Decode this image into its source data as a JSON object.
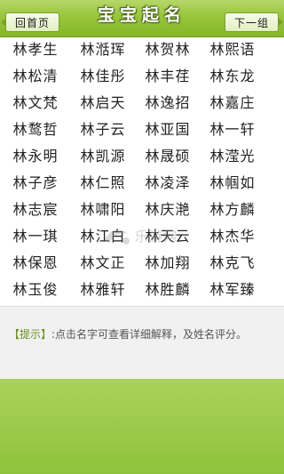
{
  "header": {
    "back_label": "回首页",
    "title": "宝宝起名",
    "next_label": "下一组"
  },
  "names": [
    [
      "林孝生",
      "林湉珲",
      "林贺林",
      "林熙语"
    ],
    [
      "林松清",
      "林佳彤",
      "林丰荏",
      "林东龙"
    ],
    [
      "林文梵",
      "林启天",
      "林逸招",
      "林嘉庄"
    ],
    [
      "林鹜哲",
      "林子云",
      "林亚国",
      "林一轩"
    ],
    [
      "林永明",
      "林凯源",
      "林晟硕",
      "林滢光"
    ],
    [
      "林子彦",
      "林仁照",
      "林凌泽",
      "林帼如"
    ],
    [
      "林志宸",
      "林啸阳",
      "林庆滟",
      "林方麟"
    ],
    [
      "林一琪",
      "林江白",
      "林天云",
      "林杰华"
    ],
    [
      "林保恩",
      "林文正",
      "林加翔",
      "林克飞"
    ],
    [
      "林玉俊",
      "林雅轩",
      "林胜麟",
      "林军臻"
    ]
  ],
  "watermark": {
    "text": "乐游网"
  },
  "tip": {
    "label": "【提示】",
    "text": ":点击名字可查看详细解释，及姓名评分。"
  },
  "colors": {
    "header_green": "#97c53b",
    "bottom_green": "#8fc23c",
    "tip_label": "#6a8f1d"
  }
}
